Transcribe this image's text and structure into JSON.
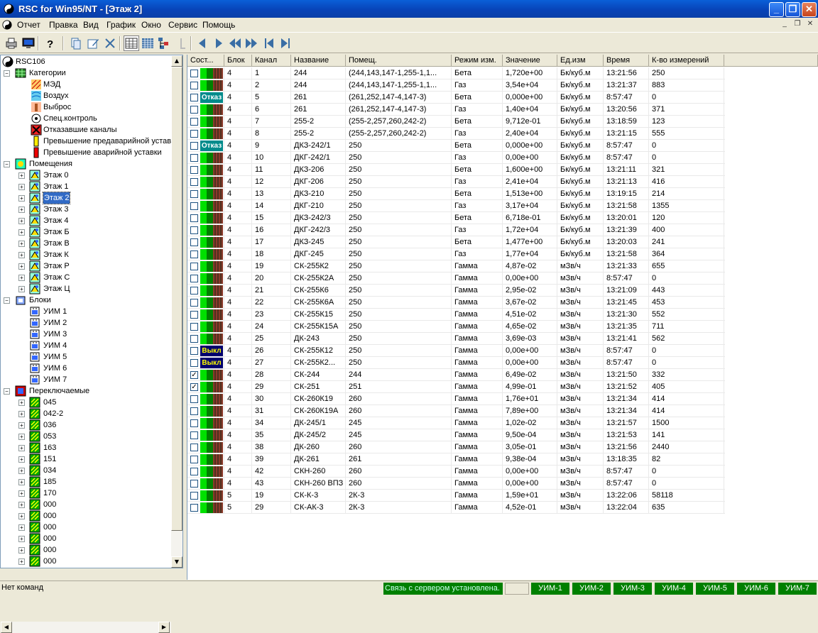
{
  "window": {
    "title": "RSC for Win95/NT - [Этаж 2]"
  },
  "menu": [
    "Отчет",
    "Правка",
    "Вид",
    "График",
    "Окно",
    "Сервис",
    "Помощь"
  ],
  "toolbar": {
    "buttons": [
      "print-icon",
      "monitor-icon",
      "help-icon",
      "copy-icon",
      "edit-icon",
      "delete-icon",
      "table-view-icon",
      "grid-view-icon",
      "tree-view-icon",
      "disabled-icon",
      "prev-icon",
      "next-icon",
      "fast-back-icon",
      "fast-forward-icon",
      "first-icon",
      "last-icon"
    ]
  },
  "tree": {
    "root": "RSC106",
    "categories": {
      "label": "Категории",
      "items": [
        "МЭД",
        "Воздух",
        "Выброс",
        "Спец.контроль",
        "Отказавшие каналы",
        "Превышение предаварийной уставки",
        "Превышение аварийной уставки"
      ]
    },
    "rooms": {
      "label": "Помещения",
      "items": [
        "Этаж 0",
        "Этаж 1",
        "Этаж 2",
        "Этаж 3",
        "Этаж 4",
        "Этаж Б",
        "Этаж В",
        "Этаж К",
        "Этаж Р",
        "Этаж С",
        "Этаж Ц"
      ],
      "selected": "Этаж 2"
    },
    "blocks": {
      "label": "Блоки",
      "items": [
        "УИМ 1",
        "УИМ 2",
        "УИМ 3",
        "УИМ 4",
        "УИМ 5",
        "УИМ 6",
        "УИМ 7"
      ]
    },
    "switchable": {
      "label": "Переключаемые",
      "items": [
        "045",
        "042-2",
        "036",
        "053",
        "163",
        "151",
        "034",
        "185",
        "170",
        "000",
        "000",
        "000",
        "000",
        "000",
        "000"
      ]
    }
  },
  "table": {
    "columns": [
      "Сост...",
      "Блок",
      "Канал",
      "Название",
      "Помещ.",
      "Режим изм.",
      "Значение",
      "Ед.изм",
      "Время",
      "К-во измерений"
    ],
    "rows": [
      {
        "checked": false,
        "state": "ok",
        "block": "4",
        "channel": "1",
        "name": "244",
        "room": "(244,143,147-1,255-1,1...",
        "mode": "Бета",
        "value": "1,720e+00",
        "unit": "Бк/куб.м",
        "time": "13:21:56",
        "count": "250"
      },
      {
        "checked": false,
        "state": "ok",
        "block": "4",
        "channel": "2",
        "name": "244",
        "room": "(244,143,147-1,255-1,1...",
        "mode": "Газ",
        "value": "3,54e+04",
        "unit": "Бк/куб.м",
        "time": "13:21:37",
        "count": "883"
      },
      {
        "checked": false,
        "state": "fail",
        "block": "4",
        "channel": "5",
        "name": "261",
        "room": "(261,252,147-4,147-3)",
        "mode": "Бета",
        "value": "0,000e+00",
        "unit": "Бк/куб.м",
        "time": "8:57:47",
        "count": "0"
      },
      {
        "checked": false,
        "state": "ok",
        "block": "4",
        "channel": "6",
        "name": "261",
        "room": "(261,252,147-4,147-3)",
        "mode": "Газ",
        "value": "1,40e+04",
        "unit": "Бк/куб.м",
        "time": "13:20:56",
        "count": "371"
      },
      {
        "checked": false,
        "state": "ok",
        "block": "4",
        "channel": "7",
        "name": "255-2",
        "room": "(255-2,257,260,242-2)",
        "mode": "Бета",
        "value": "9,712e-01",
        "unit": "Бк/куб.м",
        "time": "13:18:59",
        "count": "123"
      },
      {
        "checked": false,
        "state": "ok",
        "block": "4",
        "channel": "8",
        "name": "255-2",
        "room": "(255-2,257,260,242-2)",
        "mode": "Газ",
        "value": "2,40e+04",
        "unit": "Бк/куб.м",
        "time": "13:21:15",
        "count": "555"
      },
      {
        "checked": false,
        "state": "fail",
        "block": "4",
        "channel": "9",
        "name": "ДКЗ-242/1",
        "room": "250",
        "mode": "Бета",
        "value": "0,000e+00",
        "unit": "Бк/куб.м",
        "time": "8:57:47",
        "count": "0"
      },
      {
        "checked": false,
        "state": "ok",
        "block": "4",
        "channel": "10",
        "name": "ДКГ-242/1",
        "room": "250",
        "mode": "Газ",
        "value": "0,00e+00",
        "unit": "Бк/куб.м",
        "time": "8:57:47",
        "count": "0"
      },
      {
        "checked": false,
        "state": "ok",
        "block": "4",
        "channel": "11",
        "name": "ДКЗ-206",
        "room": "250",
        "mode": "Бета",
        "value": "1,600e+00",
        "unit": "Бк/куб.м",
        "time": "13:21:11",
        "count": "321"
      },
      {
        "checked": false,
        "state": "ok",
        "block": "4",
        "channel": "12",
        "name": "ДКГ-206",
        "room": "250",
        "mode": "Газ",
        "value": "2,41e+04",
        "unit": "Бк/куб.м",
        "time": "13:21:13",
        "count": "416"
      },
      {
        "checked": false,
        "state": "ok",
        "block": "4",
        "channel": "13",
        "name": "ДКЗ-210",
        "room": "250",
        "mode": "Бета",
        "value": "1,513e+00",
        "unit": "Бк/куб.м",
        "time": "13:19:15",
        "count": "214"
      },
      {
        "checked": false,
        "state": "ok",
        "block": "4",
        "channel": "14",
        "name": "ДКГ-210",
        "room": "250",
        "mode": "Газ",
        "value": "3,17e+04",
        "unit": "Бк/куб.м",
        "time": "13:21:58",
        "count": "1355"
      },
      {
        "checked": false,
        "state": "ok",
        "block": "4",
        "channel": "15",
        "name": "ДКЗ-242/3",
        "room": "250",
        "mode": "Бета",
        "value": "6,718e-01",
        "unit": "Бк/куб.м",
        "time": "13:20:01",
        "count": "120"
      },
      {
        "checked": false,
        "state": "ok",
        "block": "4",
        "channel": "16",
        "name": "ДКГ-242/3",
        "room": "250",
        "mode": "Газ",
        "value": "1,72e+04",
        "unit": "Бк/куб.м",
        "time": "13:21:39",
        "count": "400"
      },
      {
        "checked": false,
        "state": "ok",
        "block": "4",
        "channel": "17",
        "name": "ДКЗ-245",
        "room": "250",
        "mode": "Бета",
        "value": "1,477e+00",
        "unit": "Бк/куб.м",
        "time": "13:20:03",
        "count": "241"
      },
      {
        "checked": false,
        "state": "ok",
        "block": "4",
        "channel": "18",
        "name": "ДКГ-245",
        "room": "250",
        "mode": "Газ",
        "value": "1,77e+04",
        "unit": "Бк/куб.м",
        "time": "13:21:58",
        "count": "364"
      },
      {
        "checked": false,
        "state": "ok",
        "block": "4",
        "channel": "19",
        "name": "СК-255К2",
        "room": "250",
        "mode": "Гамма",
        "value": "4,87e-02",
        "unit": "мЗв/ч",
        "time": "13:21:33",
        "count": "655"
      },
      {
        "checked": false,
        "state": "ok",
        "block": "4",
        "channel": "20",
        "name": "СК-255К2А",
        "room": "250",
        "mode": "Гамма",
        "value": "0,00e+00",
        "unit": "мЗв/ч",
        "time": "8:57:47",
        "count": "0"
      },
      {
        "checked": false,
        "state": "ok",
        "block": "4",
        "channel": "21",
        "name": "СК-255К6",
        "room": "250",
        "mode": "Гамма",
        "value": "2,95e-02",
        "unit": "мЗв/ч",
        "time": "13:21:09",
        "count": "443"
      },
      {
        "checked": false,
        "state": "ok",
        "block": "4",
        "channel": "22",
        "name": "СК-255К6А",
        "room": "250",
        "mode": "Гамма",
        "value": "3,67e-02",
        "unit": "мЗв/ч",
        "time": "13:21:45",
        "count": "453"
      },
      {
        "checked": false,
        "state": "ok",
        "block": "4",
        "channel": "23",
        "name": "СК-255К15",
        "room": "250",
        "mode": "Гамма",
        "value": "4,51e-02",
        "unit": "мЗв/ч",
        "time": "13:21:30",
        "count": "552"
      },
      {
        "checked": false,
        "state": "ok",
        "block": "4",
        "channel": "24",
        "name": "СК-255К15А",
        "room": "250",
        "mode": "Гамма",
        "value": "4,65e-02",
        "unit": "мЗв/ч",
        "time": "13:21:35",
        "count": "711"
      },
      {
        "checked": false,
        "state": "ok",
        "block": "4",
        "channel": "25",
        "name": "ДК-243",
        "room": "250",
        "mode": "Гамма",
        "value": "3,69e-03",
        "unit": "мЗв/ч",
        "time": "13:21:41",
        "count": "562"
      },
      {
        "checked": false,
        "state": "off",
        "block": "4",
        "channel": "26",
        "name": "СК-255К12",
        "room": "250",
        "mode": "Гамма",
        "value": "0,00e+00",
        "unit": "мЗв/ч",
        "time": "8:57:47",
        "count": "0"
      },
      {
        "checked": false,
        "state": "off",
        "block": "4",
        "channel": "27",
        "name": "СК-255К2...",
        "room": "250",
        "mode": "Гамма",
        "value": "0,00e+00",
        "unit": "мЗв/ч",
        "time": "8:57:47",
        "count": "0"
      },
      {
        "checked": true,
        "state": "ok",
        "block": "4",
        "channel": "28",
        "name": "СК-244",
        "room": "244",
        "mode": "Гамма",
        "value": "6,49e-02",
        "unit": "мЗв/ч",
        "time": "13:21:50",
        "count": "332"
      },
      {
        "checked": true,
        "state": "ok",
        "block": "4",
        "channel": "29",
        "name": "СК-251",
        "room": "251",
        "mode": "Гамма",
        "value": "4,99e-01",
        "unit": "мЗв/ч",
        "time": "13:21:52",
        "count": "405"
      },
      {
        "checked": false,
        "state": "ok",
        "block": "4",
        "channel": "30",
        "name": "СК-260К19",
        "room": "260",
        "mode": "Гамма",
        "value": "1,76e+01",
        "unit": "мЗв/ч",
        "time": "13:21:34",
        "count": "414"
      },
      {
        "checked": false,
        "state": "ok",
        "block": "4",
        "channel": "31",
        "name": "СК-260К19А",
        "room": "260",
        "mode": "Гамма",
        "value": "7,89e+00",
        "unit": "мЗв/ч",
        "time": "13:21:34",
        "count": "414"
      },
      {
        "checked": false,
        "state": "ok",
        "block": "4",
        "channel": "34",
        "name": "ДК-245/1",
        "room": "245",
        "mode": "Гамма",
        "value": "1,02e-02",
        "unit": "мЗв/ч",
        "time": "13:21:57",
        "count": "1500"
      },
      {
        "checked": false,
        "state": "ok",
        "block": "4",
        "channel": "35",
        "name": "ДК-245/2",
        "room": "245",
        "mode": "Гамма",
        "value": "9,50e-04",
        "unit": "мЗв/ч",
        "time": "13:21:53",
        "count": "141"
      },
      {
        "checked": false,
        "state": "ok",
        "block": "4",
        "channel": "38",
        "name": "ДК-260",
        "room": "260",
        "mode": "Гамма",
        "value": "3,05e-01",
        "unit": "мЗв/ч",
        "time": "13:21:56",
        "count": "2440"
      },
      {
        "checked": false,
        "state": "ok",
        "block": "4",
        "channel": "39",
        "name": "ДК-261",
        "room": "261",
        "mode": "Гамма",
        "value": "9,38e-04",
        "unit": "мЗв/ч",
        "time": "13:18:35",
        "count": "82"
      },
      {
        "checked": false,
        "state": "ok",
        "block": "4",
        "channel": "42",
        "name": "СКН-260",
        "room": "260",
        "mode": "Гамма",
        "value": "0,00e+00",
        "unit": "мЗв/ч",
        "time": "8:57:47",
        "count": "0"
      },
      {
        "checked": false,
        "state": "ok",
        "block": "4",
        "channel": "43",
        "name": "СКН-260 ВПЗ",
        "room": "260",
        "mode": "Гамма",
        "value": "0,00e+00",
        "unit": "мЗв/ч",
        "time": "8:57:47",
        "count": "0"
      },
      {
        "checked": false,
        "state": "ok",
        "block": "5",
        "channel": "19",
        "name": "СК-К-3",
        "room": "2К-3",
        "mode": "Гамма",
        "value": "1,59e+01",
        "unit": "мЗв/ч",
        "time": "13:22:06",
        "count": "58118"
      },
      {
        "checked": false,
        "state": "ok",
        "block": "5",
        "channel": "29",
        "name": "СК-АК-3",
        "room": "2К-3",
        "mode": "Гамма",
        "value": "4,52e-01",
        "unit": "мЗв/ч",
        "time": "13:22:04",
        "count": "635"
      }
    ]
  },
  "state_labels": {
    "fail": "Отказ",
    "off": "Выкл"
  },
  "status": {
    "command": "Нет команд",
    "connection": "Связь с сервером установлена.",
    "uim": [
      "УИМ-1",
      "УИМ-2",
      "УИМ-3",
      "УИМ-4",
      "УИМ-5",
      "УИМ-6",
      "УИМ-7"
    ]
  },
  "colors": {
    "title_bar": "#0a4fc8",
    "status_green": "#008000",
    "fail_badge": "#008b8b",
    "off_badge": "#00006e",
    "selection": "#316ac5"
  }
}
